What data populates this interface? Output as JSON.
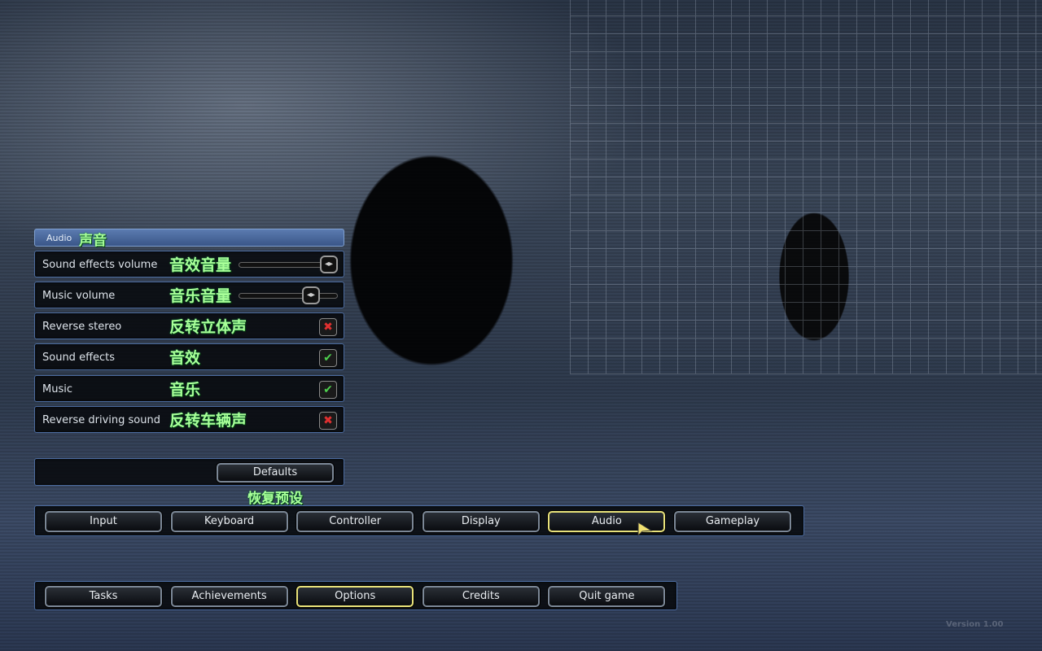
{
  "audio_panel": {
    "title": "Audio",
    "title_cn": "声音",
    "rows": [
      {
        "label": "Sound effects volume",
        "cn": "音效音量",
        "type": "slider",
        "value": 1.0
      },
      {
        "label": "Music volume",
        "cn": "音乐音量",
        "type": "slider",
        "value": 0.8
      },
      {
        "label": "Reverse stereo",
        "cn": "反转立体声",
        "type": "checkbox",
        "checked": false
      },
      {
        "label": "Sound effects",
        "cn": "音效",
        "type": "checkbox",
        "checked": true
      },
      {
        "label": "Music",
        "cn": "音乐",
        "type": "checkbox",
        "checked": true
      },
      {
        "label": "Reverse driving sound",
        "cn": "反转车辆声",
        "type": "checkbox",
        "checked": false
      }
    ],
    "defaults_label": "Defaults",
    "defaults_cn": "恢复预设"
  },
  "tabs": [
    "Input",
    "Keyboard",
    "Controller",
    "Display",
    "Audio",
    "Gameplay"
  ],
  "active_tab": "Audio",
  "menu": [
    "Tasks",
    "Achievements",
    "Options",
    "Credits",
    "Quit game"
  ],
  "active_menu": "Options",
  "version": "Version 1.00",
  "colors": {
    "check": "#4ed04e",
    "cross": "#e03030",
    "selected_border": "#e8e27a"
  }
}
